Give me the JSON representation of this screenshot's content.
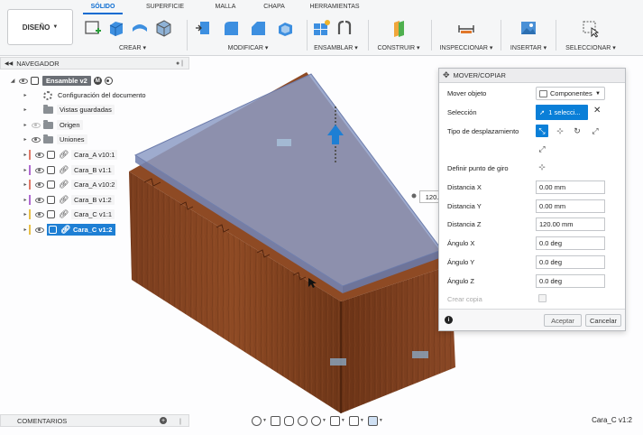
{
  "toolbar": {
    "design_button": "DISEÑO",
    "tabs": [
      "SÓLIDO",
      "SUPERFICIE",
      "MALLA",
      "CHAPA",
      "HERRAMIENTAS"
    ],
    "active_tab": "SÓLIDO",
    "groups": {
      "crear": "CREAR",
      "modificar": "MODIFICAR",
      "ensamblar": "ENSAMBLAR",
      "construir": "CONSTRUIR",
      "inspeccionar": "INSPECCIONAR",
      "insertar": "INSERTAR",
      "seleccionar": "SELECCIONAR"
    }
  },
  "navigator": {
    "title": "NAVEGADOR",
    "root": "Ensamble v2",
    "root_badge": "M",
    "items": [
      {
        "label": "Configuración del documento",
        "type": "settings"
      },
      {
        "label": "Vistas guardadas",
        "type": "folder"
      },
      {
        "label": "Origen",
        "type": "folder"
      },
      {
        "label": "Uniones",
        "type": "folder"
      },
      {
        "label": "Cara_A v10:1",
        "type": "component",
        "color": "#e07b6a"
      },
      {
        "label": "Cara_B v1:1",
        "type": "component",
        "color": "#b06ad0"
      },
      {
        "label": "Cara_A v10:2",
        "type": "component",
        "color": "#e07b6a"
      },
      {
        "label": "Cara_B v1:2",
        "type": "component",
        "color": "#b06ad0"
      },
      {
        "label": "Cara_C v1:1",
        "type": "component",
        "color": "#e8c04a"
      },
      {
        "label": "Cara_C v1:2",
        "type": "component",
        "color": "#e8c04a",
        "selected": true
      }
    ]
  },
  "comments": {
    "title": "COMENTARIOS"
  },
  "status_text": "Cara_C v1:2",
  "viewport": {
    "distance_tag": "120.00 mm"
  },
  "dialog": {
    "title": "MOVER/COPIAR",
    "rows": {
      "mover_objeto": {
        "label": "Mover objeto",
        "value": "Componentes"
      },
      "seleccion": {
        "label": "Selección",
        "value": "1 selecci..."
      },
      "tipo": {
        "label": "Tipo de desplazamiento"
      },
      "pivot": {
        "label": "Definir punto de giro"
      },
      "dx": {
        "label": "Distancia X",
        "value": "0.00 mm"
      },
      "dy": {
        "label": "Distancia Y",
        "value": "0.00 mm"
      },
      "dz": {
        "label": "Distancia Z",
        "value": "120.00 mm"
      },
      "ax": {
        "label": "Ángulo X",
        "value": "0.0 deg"
      },
      "ay": {
        "label": "Ángulo Y",
        "value": "0.0 deg"
      },
      "az": {
        "label": "Ángulo Z",
        "value": "0.0 deg"
      },
      "copy": {
        "label": "Crear copia"
      }
    },
    "ok": "Aceptar",
    "cancel": "Cancelar"
  }
}
